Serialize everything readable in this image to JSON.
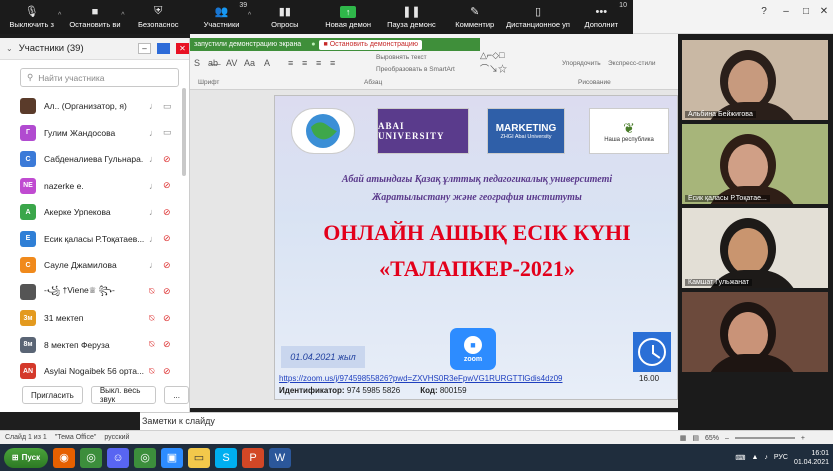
{
  "zoom_toolbar": {
    "items": [
      {
        "label": "Выключить з",
        "icon": "microphone-icon"
      },
      {
        "label": "Остановить ви",
        "icon": "video-camera-icon"
      },
      {
        "label": "Безопаснос",
        "icon": "shield-icon"
      },
      {
        "label": "Участники",
        "icon": "participants-icon",
        "badge": "39"
      },
      {
        "label": "Опросы",
        "icon": "polls-icon"
      },
      {
        "label": "Новая демон",
        "icon": "share-screen-icon"
      },
      {
        "label": "Пауза демонс",
        "icon": "pause-icon"
      },
      {
        "label": "Комментир",
        "icon": "annotate-icon"
      },
      {
        "label": "Дистанционное уп",
        "icon": "remote-control-icon"
      },
      {
        "label": "Дополнит",
        "icon": "more-icon",
        "badge": "10"
      }
    ]
  },
  "share_bar": {
    "status": "запустили демонстрацию экрана",
    "stop_label": "Остановить демонстрацию"
  },
  "ribbon": {
    "labels": [
      "Шрифт",
      "Абзац",
      "Рисование",
      "Упорядочить",
      "Экспресс-стили",
      "Выровнять текст",
      "Преобразовать в SmartArt"
    ]
  },
  "participants": {
    "title": "Участники (39)",
    "search_placeholder": "Найти участника",
    "list": [
      {
        "initials": "",
        "name": "Ал.. (Организатор, я)",
        "color": "#5a3b2a",
        "mic_muted": false,
        "cam_off": false
      },
      {
        "initials": "Г",
        "name": "Гулим Жандосова",
        "color": "#b14bd0",
        "mic_muted": false,
        "cam_off": false
      },
      {
        "initials": "С",
        "name": "Сабденалиева Гульнара...",
        "color": "#3b7ad8",
        "mic_muted": false,
        "cam_off": true
      },
      {
        "initials": "NE",
        "name": "nazerke e.",
        "color": "#c04bd1",
        "mic_muted": false,
        "cam_off": true
      },
      {
        "initials": "А",
        "name": "Акерке Урпекова",
        "color": "#3aa64a",
        "mic_muted": false,
        "cam_off": true
      },
      {
        "initials": "Е",
        "name": "Есик қаласы Р.Тоқатаев...",
        "color": "#2f7fd6",
        "mic_muted": false,
        "cam_off": true
      },
      {
        "initials": "С",
        "name": "Сауле Джамилова",
        "color": "#f08a1c",
        "mic_muted": false,
        "cam_off": true
      },
      {
        "initials": "",
        "name": "-꧁ †Viene♕ ꧂-",
        "color": "#555",
        "mic_muted": true,
        "cam_off": true
      },
      {
        "initials": "3м",
        "name": "31 мектеп",
        "color": "#e39a1f",
        "mic_muted": true,
        "cam_off": true
      },
      {
        "initials": "8м",
        "name": "8 мектеп Феруза",
        "color": "#5a6575",
        "mic_muted": true,
        "cam_off": true
      },
      {
        "initials": "AN",
        "name": "Asylai Nogaibek 56 орта...",
        "color": "#d4392b",
        "mic_muted": true,
        "cam_off": true
      }
    ],
    "invite_label": "Пригласить",
    "mute_all_label": "Выкл. весь звук",
    "more_label": "..."
  },
  "slide": {
    "logo_univ": "ABAI UNIVERSITY",
    "logo_marketing": "MARKETING",
    "logo_marketing_sub": "ZHGI Abai University",
    "logo_geo": "Наша республика",
    "university_line1": "Абай атындағы Қазақ ұлттық педагогикалық университеті",
    "university_line2": "Жаратылыстану және география институты",
    "title_line1": "ОНЛАЙН АШЫҚ ЕСІК КҮНІ",
    "title_line2": "«ТАЛАПКЕР-2021»",
    "date": "01.04.2021 жыл",
    "zoom_text": "zoom",
    "time": "16.00",
    "url": "https://zoom.us/j/97459855826?pwd=ZXVHS0R3eFpwVG1RURGTTlGdis4dz09",
    "meeting_id_label": "Идентификатор:",
    "meeting_id": "974 5985 5826",
    "code_label": "Код:",
    "code": "800159"
  },
  "notes_placeholder": "Заметки к слайду",
  "status_bar": {
    "slide": "Слайд 1 из 1",
    "theme": "\"Тема Office\"",
    "language": "русский",
    "zoom": "65%"
  },
  "videos": [
    {
      "name": "Альбина Бейжигова",
      "bg": "#c9b8a4",
      "face": "#c79a7e",
      "hair": "#2a1f1a"
    },
    {
      "name": "Есик қаласы Р.Тоқатае...",
      "bg": "#a7b57a",
      "face": "#d09f86",
      "hair": "#2f1e16"
    },
    {
      "name": "Камшат Гульжанат",
      "bg": "#e3dfd6",
      "face": "#c9956f",
      "hair": "#1d1a18"
    },
    {
      "name": "",
      "bg": "#6c4a3c",
      "face": "#c99378",
      "hair": "#1e1512"
    }
  ],
  "taskbar": {
    "start_label": "Пуск",
    "apps": [
      "firefox-icon",
      "chrome-icon",
      "discord-icon",
      "chrome-icon",
      "zoom-icon",
      "explorer-icon",
      "skype-icon",
      "powerpoint-icon",
      "word-icon"
    ],
    "lang": "РУС",
    "time": "16:01",
    "date": "01.04.2021"
  }
}
